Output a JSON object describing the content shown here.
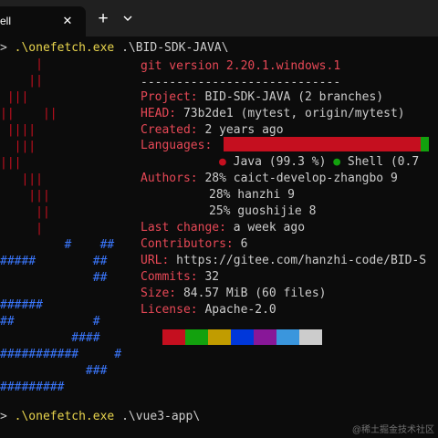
{
  "window": {
    "tab_title": "ell",
    "tab_close_glyph": "✕",
    "new_tab_glyph": "+"
  },
  "terminal": {
    "prompt_symbol": ">",
    "first_command": {
      "program": ".\\onefetch.exe",
      "argument": ".\\BID-SDK-JAVA\\"
    },
    "last_command": {
      "program": ".\\onefetch.exe",
      "argument": ".\\vue3-app\\"
    }
  },
  "ascii_art": {
    "red_lines": [
      "     |",
      "    ||",
      " |||",
      "||    ||",
      " ||||",
      "  |||",
      "|||",
      "   |||",
      "    |||",
      "     ||",
      "     |"
    ],
    "blue_lines": [
      "         #    ##",
      "#####        ##",
      "             ##",
      "######",
      "##           #",
      "          ####",
      "###########     #",
      "            ###",
      "#########"
    ]
  },
  "info": {
    "header": "git version 2.20.1.windows.1",
    "separator": "----------------------------",
    "project_key": "Project:",
    "project_value": " BID-SDK-JAVA (2 branches)",
    "head_key": "HEAD:",
    "head_value": " 73b2de1 (mytest, origin/mytest)",
    "created_key": "Created:",
    "created_value": " 2 years ago",
    "languages_key": "Languages:",
    "languages": [
      {
        "name": "Java",
        "percent": "99.3 %",
        "fraction": 0.96,
        "color": "#c50f1f"
      },
      {
        "name": "Shell",
        "percent": "0.7",
        "fraction": 0.04,
        "color": "#13a10e"
      }
    ],
    "java_legend": " Java (99.3 %) ",
    "shell_legend": " Shell (0.7",
    "legend_dot": "●",
    "authors_key": "Authors:",
    "authors": [
      {
        "share": " 28%",
        "name": " caict-develop-zhangbo 9"
      },
      {
        "share": "28%",
        "name": " hanzhi 9"
      },
      {
        "share": "25%",
        "name": " guoshijie 8"
      }
    ],
    "last_change_key": "Last change:",
    "last_change_value": " a week ago",
    "contributors_key": "Contributors:",
    "contributors_value": " 6",
    "url_key": "URL:",
    "url_value": " https://gitee.com/hanzhi-code/BID-S",
    "commits_key": "Commits:",
    "commits_value": " 32",
    "size_key": "Size:",
    "size_value": " 84.57 MiB (60 files)",
    "license_key": "License:",
    "license_value": " Apache-2.0"
  },
  "palette": [
    "#c50f1f",
    "#13a10e",
    "#c19c00",
    "#0037da",
    "#881798",
    "#3a96dd",
    "#cccccc"
  ],
  "watermark": "@稀土掘金技术社区"
}
